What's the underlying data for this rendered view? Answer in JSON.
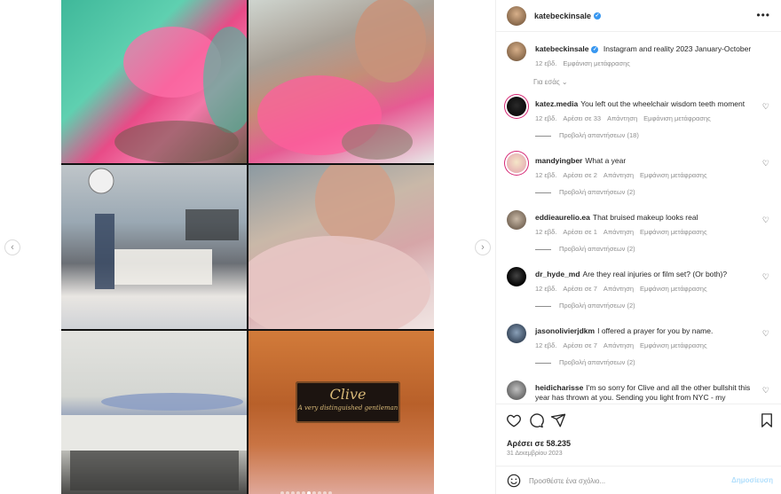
{
  "post": {
    "username": "katebeckinsale",
    "caption": "Instagram and reality 2023 January-October",
    "caption_age": "12 εβδ.",
    "caption_translate": "Εμφάνιση μετάφρασης",
    "for_you": "Για εσάς",
    "plaque_title": "Clive",
    "plaque_subtitle": "A very distinguished gentleman",
    "likes": "Αρέσει σε 58.235",
    "date": "31 Δεκεμβρίου 2023",
    "add_comment_placeholder": "Προσθέστε ένα σχόλιο...",
    "post_label": "Δημοσίευση"
  },
  "comments": [
    {
      "user": "katez.media",
      "text": "You left out the wheelchair wisdom teeth moment",
      "age": "12 εβδ.",
      "likes": "Αρέσει σε 33",
      "reply": "Απάντηση",
      "translate": "Εμφάνιση μετάφρασης",
      "replies": "Προβολή απαντήσεων (18)"
    },
    {
      "user": "mandyingber",
      "text": "What a year",
      "age": "12 εβδ.",
      "likes": "Αρέσει σε 2",
      "reply": "Απάντηση",
      "translate": "Εμφάνιση μετάφρασης",
      "replies": "Προβολή απαντήσεων (2)"
    },
    {
      "user": "eddieaurelio.ea",
      "text": "That bruised makeup looks real",
      "age": "12 εβδ.",
      "likes": "Αρέσει σε 1",
      "reply": "Απάντηση",
      "translate": "Εμφάνιση μετάφρασης",
      "replies": "Προβολή απαντήσεων (2)"
    },
    {
      "user": "dr_hyde_md",
      "text": "Are they real injuries or film set? (Or both)?",
      "age": "12 εβδ.",
      "likes": "Αρέσει σε 7",
      "reply": "Απάντηση",
      "translate": "Εμφάνιση μετάφρασης",
      "replies": "Προβολή απαντήσεων (2)"
    },
    {
      "user": "jasonolivierjdkm",
      "text": "I offered a prayer for you by name.",
      "age": "12 εβδ.",
      "likes": "Αρέσει σε 7",
      "reply": "Απάντηση",
      "translate": "Εμφάνιση μετάφρασης",
      "replies": "Προβολή απαντήσεων (2)"
    },
    {
      "user": "heidicharisse",
      "text": "I'm so sorry for Clive and all the other bullshit this year has thrown at you. Sending you light from NYC - my"
    }
  ],
  "icons": {
    "more": "more-horizontal-icon",
    "heart": "heart-icon",
    "comment": "comment-icon",
    "share": "share-icon",
    "save": "bookmark-icon",
    "emoji": "emoji-icon",
    "prev": "chevron-left-icon",
    "next": "chevron-right-icon"
  },
  "carousel": {
    "count": 10,
    "active_index": 5
  },
  "colors": {
    "verified": "#3897f0",
    "link_disabled": "#b2dffc",
    "muted": "#8e8e8e"
  }
}
